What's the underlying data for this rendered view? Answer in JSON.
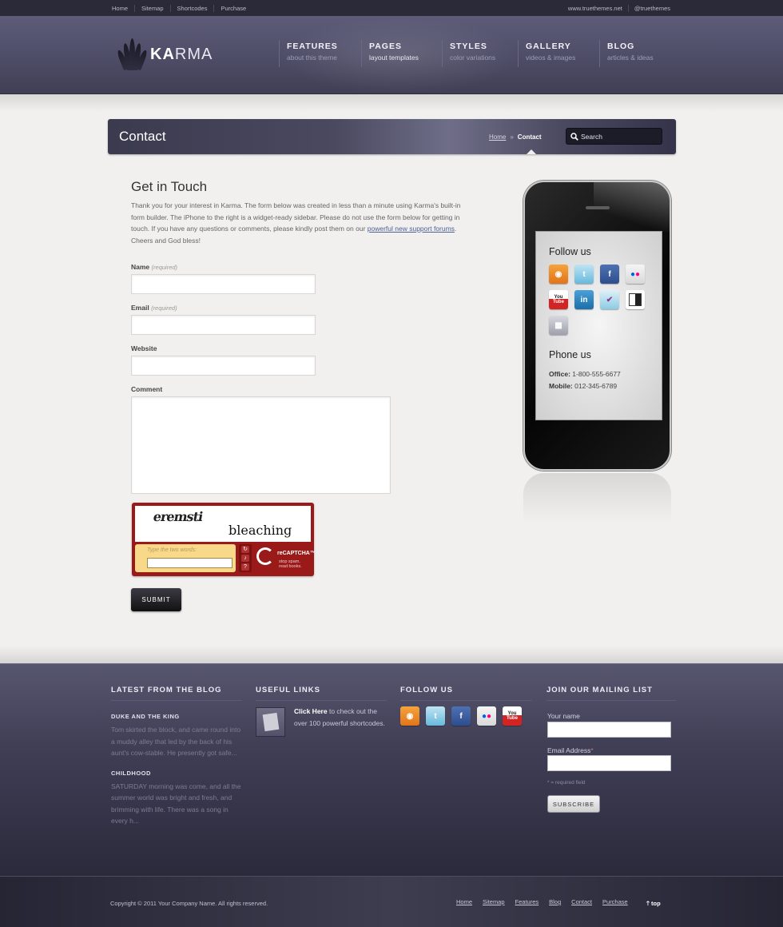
{
  "topbar": {
    "links": [
      "Home",
      "Sitemap",
      "Shortcodes",
      "Purchase"
    ],
    "right_links": [
      "www.truethemes.net",
      "@truethemes"
    ]
  },
  "header": {
    "logo_bold": "KA",
    "logo_rest": "RMA",
    "nav": [
      {
        "title": "FEATURES",
        "subtitle": "about this theme"
      },
      {
        "title": "PAGES",
        "subtitle": "layout templates"
      },
      {
        "title": "STYLES",
        "subtitle": "color variations"
      },
      {
        "title": "GALLERY",
        "subtitle": "videos & images"
      },
      {
        "title": "BLOG",
        "subtitle": "articles & ideas"
      }
    ]
  },
  "titlebar": {
    "title": "Contact",
    "breadcrumb_home": "Home",
    "breadcrumb_sep": "»",
    "breadcrumb_current": "Contact",
    "search_placeholder": "Search"
  },
  "intro": {
    "heading": "Get in Touch",
    "text_before_link": "Thank you for your interest in Karma. The form below was created in less than a minute using Karma's built-in form builder. The iPhone to the right is a widget-ready sidebar. Please do not use the form below for getting in touch. If you have any questions or comments, please kindly post them on our ",
    "link_text": "powerful new support forums",
    "text_after_link": ". Cheers and God bless!"
  },
  "form": {
    "name_label": "Name",
    "email_label": "Email",
    "required_note": "(required)",
    "website_label": "Website",
    "comment_label": "Comment",
    "captcha_word1": "eremsti",
    "captcha_word2": "bleaching",
    "captcha_hint": "Type the two words:",
    "captcha_brand": "reCAPTCHA™",
    "captcha_tagline1": "stop spam.",
    "captcha_tagline2": "read books.",
    "submit_label": "SUBMIT"
  },
  "sidebar": {
    "follow_title": "Follow us",
    "icons": [
      "rss-icon",
      "twitter-icon",
      "facebook-icon",
      "flickr-icon",
      "youtube-icon",
      "linkedin-icon",
      "foursquare-icon",
      "delicious-icon",
      "myspace-icon"
    ],
    "phone_title": "Phone us",
    "office_label": "Office:",
    "office_value": "1-800-555-6677",
    "mobile_label": "Mobile:",
    "mobile_value": "012-345-6789"
  },
  "footer": {
    "blog_title": "LATEST FROM THE BLOG",
    "posts": [
      {
        "title": "DUKE AND THE KING",
        "excerpt": "Tom skirted the block, and came round into a muddy alley that led by the back of his aunt's cow-stable. He presently got safe..."
      },
      {
        "title": "CHILDHOOD",
        "excerpt": "SATURDAY morning was come, and all the summer world was bright and fresh, and brimming with life. There was a song in every h..."
      }
    ],
    "links_title": "USEFUL LINKS",
    "links_bold": "Click Here",
    "links_text": " to check out the over 100 powerful shortcodes.",
    "follow_title": "FOLLOW US",
    "follow_icons": [
      "rss-icon",
      "twitter-icon",
      "facebook-icon",
      "flickr-icon",
      "youtube-icon"
    ],
    "mailing_title": "JOIN OUR MAILING LIST",
    "name_label": "Your name",
    "email_label": "Email Address",
    "required_mark": "*",
    "required_note": "* = required field",
    "subscribe_label": "SUBSCRIBE"
  },
  "bottombar": {
    "copyright": "Copyright © 2011 Your Company Name. All rights reserved.",
    "links": [
      "Home",
      "Sitemap",
      "Features",
      "Blog",
      "Contact",
      "Purchase"
    ],
    "top_label": "top"
  }
}
